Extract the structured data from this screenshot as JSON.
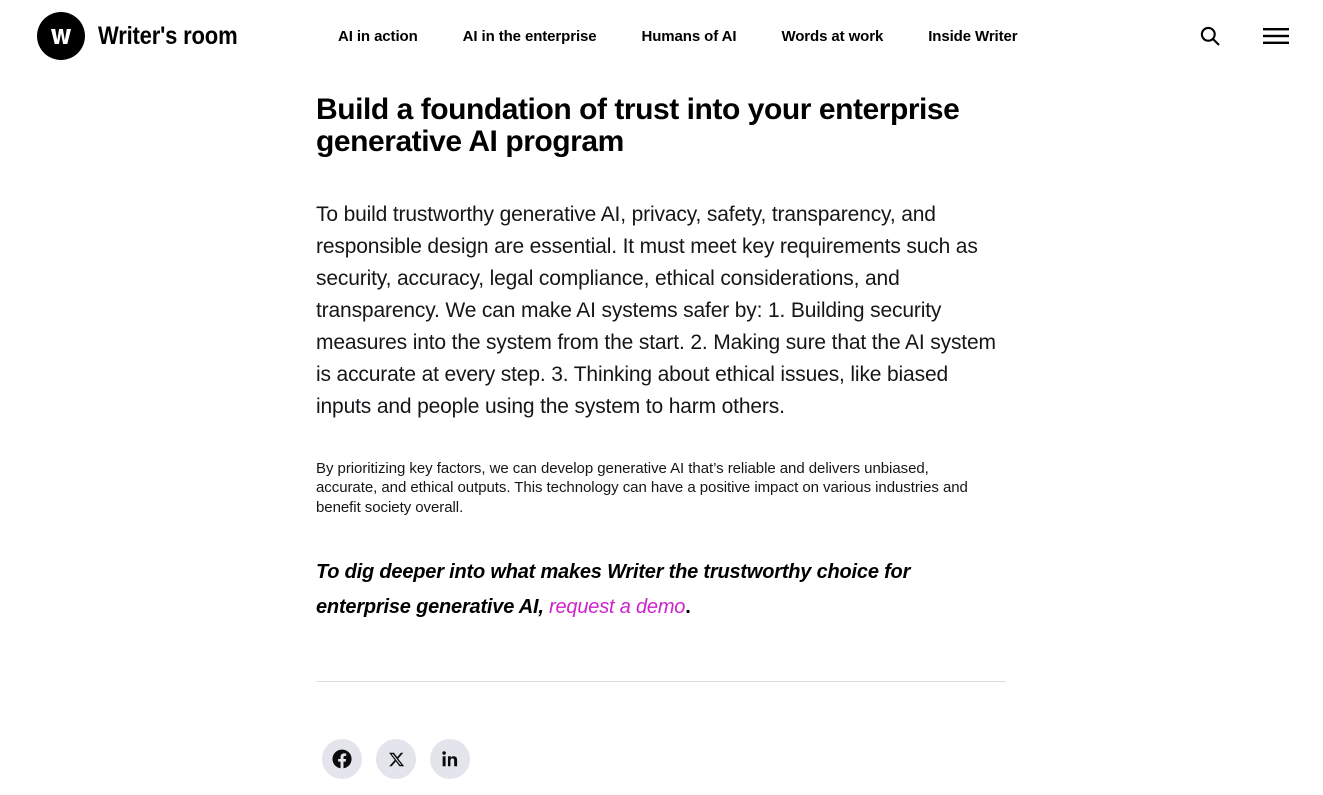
{
  "header": {
    "brand": {
      "mark_icon": "writer-w-logo-icon",
      "wordmark": "Writer's room"
    },
    "nav": [
      {
        "label": "AI in action"
      },
      {
        "label": "AI in the enterprise"
      },
      {
        "label": "Humans of AI"
      },
      {
        "label": "Words at work"
      },
      {
        "label": "Inside Writer"
      }
    ],
    "actions": {
      "search_icon": "search-icon",
      "search_label": "Search",
      "menu_icon": "hamburger-menu-icon",
      "menu_label": "Menu"
    }
  },
  "article": {
    "title": "Build a foundation of trust into your enterprise generative AI program",
    "body": "To build trustworthy generative AI, privacy, safety, transparency, and responsible design are essential. It must meet key requirements such as security, accuracy, legal compliance, ethical considerations, and transparency. We can make AI systems safer by: 1. Building security measures into the system from the start. 2. Making sure that the AI system is accurate at every step. 3. Thinking about ethical issues, like biased inputs and people using the system to harm others.",
    "note": "By prioritizing key factors, we can develop generative AI that’s reliable and delivers unbiased, accurate, and ethical outputs. This technology can have a positive impact on various industries and benefit society overall.",
    "cta_lead": "To dig deeper into what makes Writer the trustworthy choice for enterprise generative AI,",
    "cta_link": "request a demo",
    "cta_period": "."
  },
  "share": {
    "items": [
      {
        "name": "facebook",
        "icon": "facebook-icon",
        "label": "Share on Facebook"
      },
      {
        "name": "x",
        "icon": "x-twitter-icon",
        "label": "Share on X"
      },
      {
        "name": "linkedin",
        "icon": "linkedin-icon",
        "label": "Share on LinkedIn"
      }
    ]
  },
  "colors": {
    "accent_link": "#cc23cc",
    "brand_black": "#000000",
    "share_bg": "#e3e4ec",
    "divider": "#dcdde6",
    "page_bg": "#ffffff"
  }
}
